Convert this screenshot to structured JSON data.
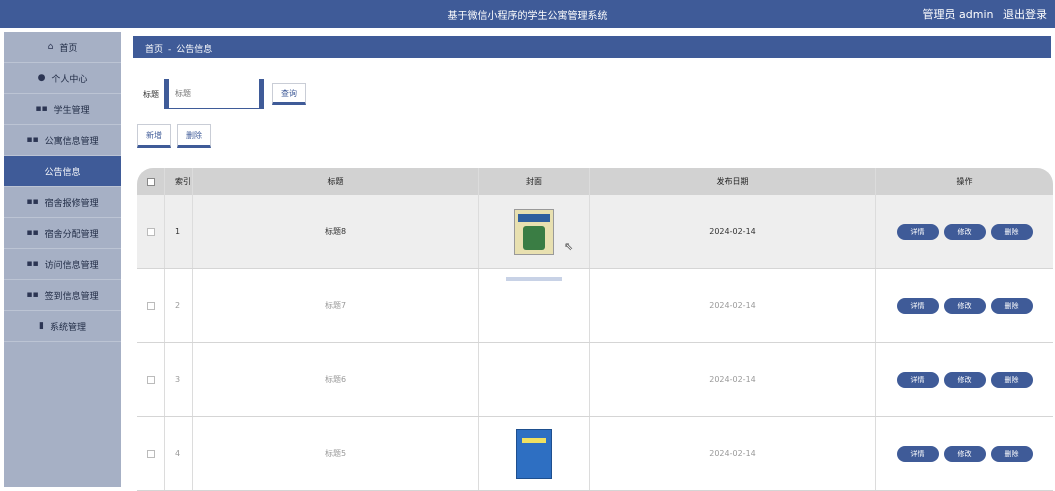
{
  "header": {
    "title": "基于微信小程序的学生公寓管理系统",
    "user": "管理员 admin",
    "logout": "退出登录"
  },
  "sidebar": {
    "items": [
      {
        "label": "首页",
        "icon": "home-icon",
        "glyph": "⌂"
      },
      {
        "label": "个人中心",
        "icon": "user-icon",
        "glyph": "●"
      },
      {
        "label": "学生管理",
        "icon": "grid-icon",
        "glyph": "▪▪"
      },
      {
        "label": "公寓信息管理",
        "icon": "grid-icon",
        "glyph": "▪▪"
      },
      {
        "label": "公告信息",
        "icon": "",
        "glyph": ""
      },
      {
        "label": "宿舍报修管理",
        "icon": "grid-icon",
        "glyph": "▪▪"
      },
      {
        "label": "宿舍分配管理",
        "icon": "grid-icon",
        "glyph": "▪▪"
      },
      {
        "label": "访问信息管理",
        "icon": "grid-icon",
        "glyph": "▪▪"
      },
      {
        "label": "签到信息管理",
        "icon": "grid-icon",
        "glyph": "▪▪"
      },
      {
        "label": "系统管理",
        "icon": "lock-icon",
        "glyph": "▮"
      }
    ],
    "active_index": 4
  },
  "breadcrumb": {
    "home": "首页",
    "separator": "-",
    "current": "公告信息"
  },
  "search": {
    "label": "标题",
    "placeholder": "标题",
    "button": "查询"
  },
  "actions": {
    "add": "新增",
    "delete": "删除"
  },
  "table": {
    "columns": [
      "索引",
      "标题",
      "封面",
      "发布日期",
      "操作"
    ],
    "rows": [
      {
        "index": "1",
        "title": "标题8",
        "date": "2024-02-14",
        "cover": "book-cover"
      },
      {
        "index": "2",
        "title": "标题7",
        "date": "2024-02-14",
        "cover": "strip"
      },
      {
        "index": "3",
        "title": "标题6",
        "date": "2024-02-14",
        "cover": "blank"
      },
      {
        "index": "4",
        "title": "标题5",
        "date": "2024-02-14",
        "cover": "blue-book"
      }
    ],
    "row_buttons": {
      "detail": "详情",
      "edit": "修改",
      "delete": "删除"
    }
  },
  "colors": {
    "primary": "#3f5b98",
    "sidebar": "#a6b0c5",
    "header_row": "#d2d2d2"
  }
}
